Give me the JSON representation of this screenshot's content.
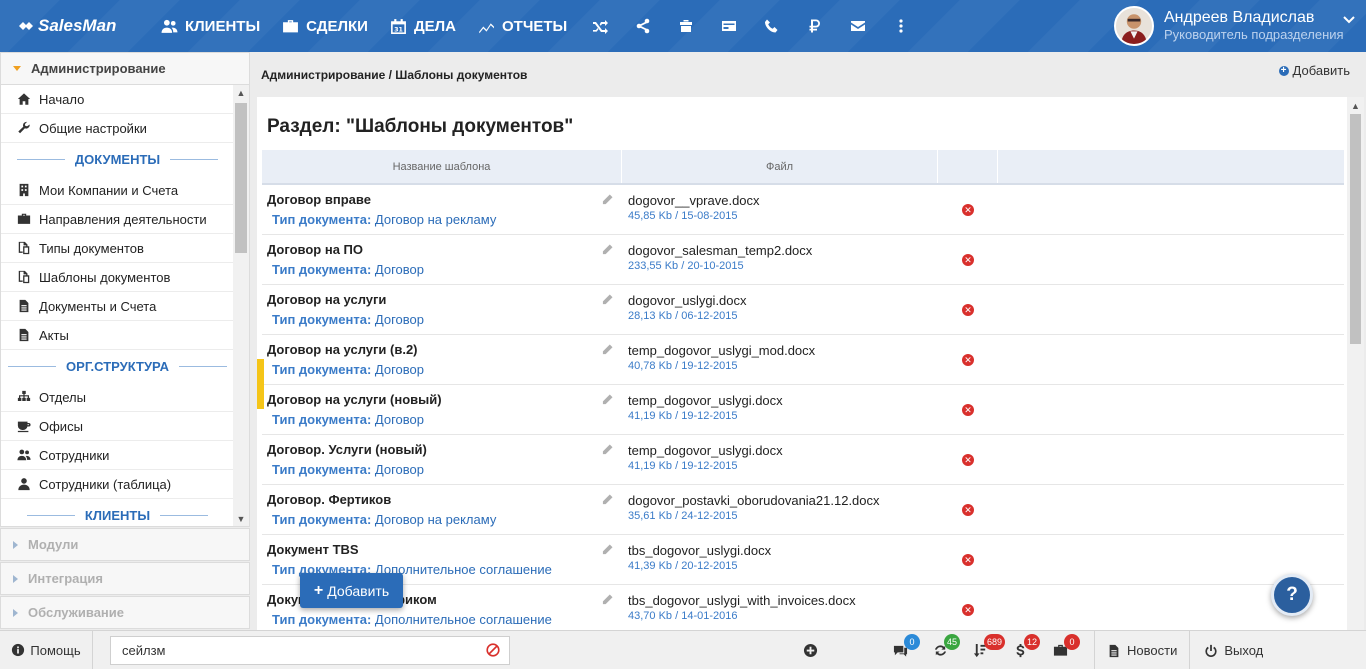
{
  "app": {
    "logo": "SalesMan"
  },
  "nav": {
    "items": [
      {
        "label": "КЛИЕНТЫ",
        "icon": "users-icon"
      },
      {
        "label": "СДЕЛКИ",
        "icon": "briefcase-icon"
      },
      {
        "label": "ДЕЛА",
        "icon": "calendar-icon",
        "icon_text": "31"
      },
      {
        "label": "ОТЧЕТЫ",
        "icon": "chart-line-icon"
      }
    ],
    "icons": [
      "shuffle-icon",
      "share-icon",
      "cart-icon",
      "card-icon",
      "phone-icon",
      "ruble-icon",
      "mail-icon",
      "more-icon"
    ]
  },
  "user": {
    "name": "Андреев Владислав",
    "role": "Руководитель подразделения"
  },
  "sidebar": {
    "active_section": "Администрирование",
    "items_top": [
      {
        "label": "Начало",
        "icon": "home-icon"
      },
      {
        "label": "Общие настройки",
        "icon": "wrench-icon"
      }
    ],
    "group_docs": "ДОКУМЕНТЫ",
    "items_docs": [
      {
        "label": "Мои Компании и Счета",
        "icon": "building-icon"
      },
      {
        "label": "Направления деятельности",
        "icon": "briefcase-icon"
      },
      {
        "label": "Типы документов",
        "icon": "copy-icon"
      },
      {
        "label": "Шаблоны документов",
        "icon": "copy-icon"
      },
      {
        "label": "Документы и Счета",
        "icon": "file-icon"
      },
      {
        "label": "Акты",
        "icon": "file-icon"
      }
    ],
    "group_org": "ОРГ.СТРУКТУРА",
    "items_org": [
      {
        "label": "Отделы",
        "icon": "sitemap-icon"
      },
      {
        "label": "Офисы",
        "icon": "coffee-icon"
      },
      {
        "label": "Сотрудники",
        "icon": "users-icon"
      },
      {
        "label": "Сотрудники (таблица)",
        "icon": "user-icon"
      }
    ],
    "group_clients": "КЛИЕНТЫ",
    "collapsed_sections": [
      "Модули",
      "Интеграция",
      "Обслуживание"
    ]
  },
  "main": {
    "breadcrumb": "Администрирование / Шаблоны документов",
    "add_label": "Добавить",
    "title": "Раздел: \"Шаблоны документов\"",
    "columns": {
      "name": "Название шаблона",
      "file": "Файл"
    },
    "type_label": "Тип документа:",
    "rows": [
      {
        "name": "Договор вправе",
        "type": "Договор на рекламу",
        "file": "dogovor__vprave.docx",
        "meta": "45,85 Kb / 15-08-2015"
      },
      {
        "name": "Договор на ПО",
        "type": "Договор",
        "file": "dogovor_salesman_temp2.docx",
        "meta": "233,55 Kb / 20-10-2015"
      },
      {
        "name": "Договор на услуги",
        "type": "Договор",
        "file": "dogovor_uslygi.docx",
        "meta": "28,13 Kb / 06-12-2015"
      },
      {
        "name": "Договор на услуги (в.2)",
        "type": "Договор",
        "file": "temp_dogovor_uslygi_mod.docx",
        "meta": "40,78 Kb / 19-12-2015"
      },
      {
        "name": "Договор на услуги (новый)",
        "type": "Договор",
        "file": "temp_dogovor_uslygi.docx",
        "meta": "41,19 Kb / 19-12-2015"
      },
      {
        "name": "Договор. Услуги (новый)",
        "type": "Договор",
        "file": "temp_dogovor_uslygi.docx",
        "meta": "41,19 Kb / 19-12-2015"
      },
      {
        "name": "Договор. Фертиков",
        "type": "Договор на рекламу",
        "file": "dogovor_postavki_oborudovania21.12.docx",
        "meta": "35,61 Kb / 24-12-2015"
      },
      {
        "name": "Документ TBS",
        "type": "Дополнительное соглашение",
        "file": "tbs_dogovor_uslygi.docx",
        "meta": "41,39 Kb / 20-12-2015"
      },
      {
        "name": "Документ TBS с графиком",
        "type": "Дополнительное соглашение",
        "file": "tbs_dogovor_uslygi_with_invoices.docx",
        "meta": "43,70 Kb / 14-01-2016"
      }
    ],
    "float_add_label": "Добавить",
    "help_label": "?"
  },
  "bottom": {
    "help_label": "Помощь",
    "search_value": "сейлзм",
    "badges": [
      {
        "icon": "comments-icon",
        "count": "0",
        "color": "#2b8ad8"
      },
      {
        "icon": "refresh-icon",
        "count": "45",
        "color": "#3aa640"
      },
      {
        "icon": "sort-icon",
        "count": "689",
        "color": "#d9302c"
      },
      {
        "icon": "dollar-icon",
        "count": "12",
        "color": "#d9302c"
      },
      {
        "icon": "briefcase-icon",
        "count": "0",
        "color": "#d9302c"
      }
    ],
    "news_label": "Новости",
    "exit_label": "Выход"
  }
}
